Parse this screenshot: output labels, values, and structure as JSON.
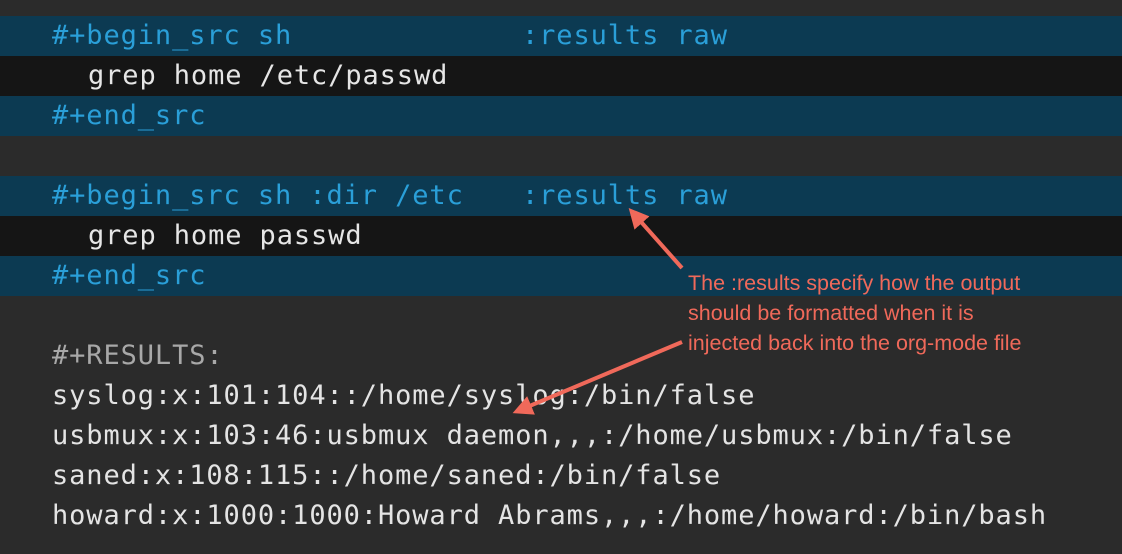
{
  "block1": {
    "begin_left": "#+begin_src sh",
    "begin_right": ":results raw",
    "code": "grep home /etc/passwd",
    "end": "#+end_src"
  },
  "block2": {
    "begin_left": "#+begin_src sh :dir /etc",
    "begin_right": ":results raw",
    "code": "grep home passwd",
    "end": "#+end_src"
  },
  "results": {
    "header": "#+RESULTS:",
    "lines": [
      "syslog:x:101:104::/home/syslog:/bin/false",
      "usbmux:x:103:46:usbmux daemon,,,:/home/usbmux:/bin/false",
      "saned:x:108:115::/home/saned:/bin/false",
      "howard:x:1000:1000:Howard Abrams,,,:/home/howard:/bin/bash"
    ]
  },
  "annotation": {
    "lines": [
      "The :results specify how the output",
      "should be formatted when it is",
      "injected back into the org-mode file"
    ],
    "color": "#f0695a"
  },
  "colors": {
    "background": "#2b2b2b",
    "src_delimiter_bg": "#0c3a52",
    "src_delimiter_fg": "#2a9fd8",
    "src_body_bg": "#151515"
  }
}
